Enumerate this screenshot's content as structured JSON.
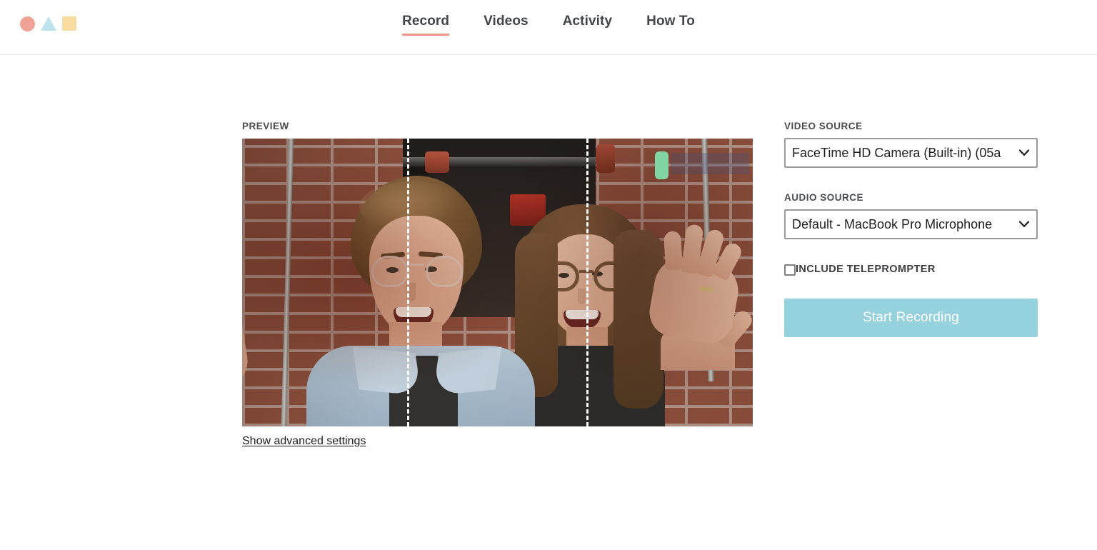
{
  "header": {
    "logo": {
      "shapes": [
        "circle",
        "triangle",
        "square"
      ],
      "circle_color": "#f0a294",
      "triangle_color": "#bde3ec",
      "square_color": "#f9dca2"
    },
    "nav": [
      {
        "label": "Record",
        "active": true
      },
      {
        "label": "Videos",
        "active": false
      },
      {
        "label": "Activity",
        "active": false
      },
      {
        "label": "How To",
        "active": false
      }
    ],
    "active_underline_color": "#f0998a"
  },
  "preview": {
    "label": "PREVIEW",
    "advanced_link": "Show advanced settings",
    "overlay": {
      "guide_lines": 2,
      "guide_color": "#ffffff",
      "indicator_color": "#80d5a3"
    }
  },
  "settings": {
    "video_source": {
      "label": "VIDEO SOURCE",
      "value": "FaceTime HD Camera (Built-in) (05a",
      "options": [
        "FaceTime HD Camera (Built-in) (05a"
      ]
    },
    "audio_source": {
      "label": "AUDIO SOURCE",
      "value": "Default - MacBook Pro Microphone",
      "options": [
        "Default - MacBook Pro Microphone"
      ]
    },
    "teleprompter": {
      "label": "INCLUDE TELEPROMPTER",
      "checked": false
    },
    "start_button": {
      "label": "Start Recording",
      "color": "#96d2dd",
      "text_color": "#ffffff"
    }
  }
}
